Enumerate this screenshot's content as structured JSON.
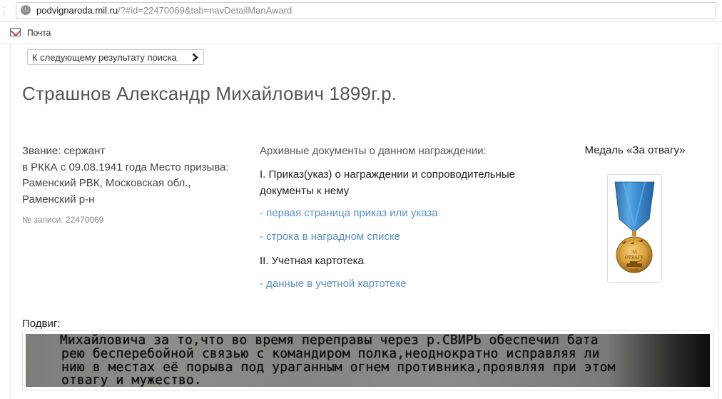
{
  "browser": {
    "url_domain": "podvignaroda.mil.ru",
    "url_path": "/?#id=22470069&tab=navDetailManAward",
    "bookmark_label": "Почта"
  },
  "nav": {
    "next_result_label": "К следующему результату поиска"
  },
  "person": {
    "name": "Страшнов Александр Михайлович 1899г.р.",
    "rank_line1": "Звание: сержант",
    "rank_line2": "в РККА с 09.08.1941 года Место призыва: Раменский РВК, Московская обл., Раменский р-н",
    "record_no": "№ записи: 22470069"
  },
  "documents": {
    "heading": "Архивные документы о данном награждении:",
    "section1_title": "I. Приказ(указ) о награждении и сопроводительные документы к нему",
    "link_first_page": "- первая страница приказ или указа",
    "link_award_list": "- строка в наградном списке",
    "section2_title": "II. Учетная картотека",
    "link_card_index": "- данные в учетной картотеке"
  },
  "medal": {
    "title": "Медаль «За отвагу»",
    "inscription_top": "ЗА",
    "inscription_bottom": "ОТВАГУ",
    "inscription_base": "СССР"
  },
  "feat": {
    "label": "Подвиг:",
    "line1": "Михайловича за то,что во время переправы через р.СВИРЬ обеспечил бата",
    "line2": "рею бесперебойной связью с командиром полка,неоднократно исправляя ли",
    "line3": "нию в местах её порыва под ураганным огнем противника,проявляя при этом",
    "line4": "отвагу и мужество."
  },
  "colors": {
    "link": "#5b8fc7",
    "ribbon": "#3f8fd0",
    "medal_gold": "#d9a23a"
  }
}
